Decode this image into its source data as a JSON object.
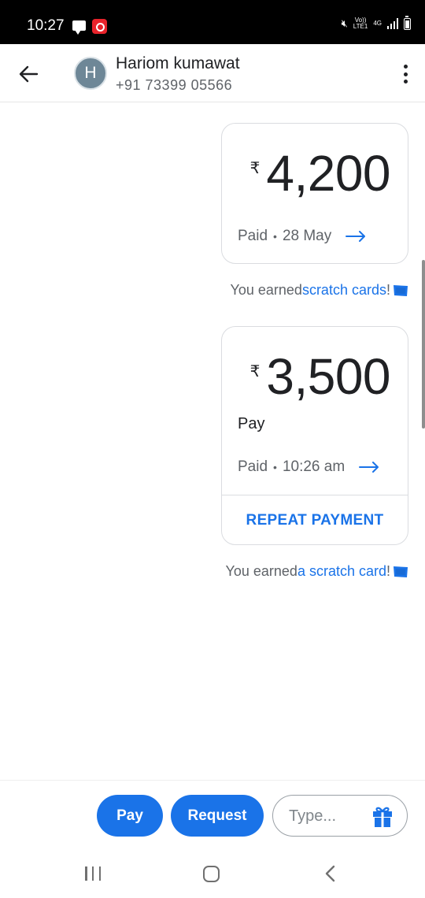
{
  "status_bar": {
    "time": "10:27",
    "volte_label": "Vo)) LTE1",
    "network_label": "4G"
  },
  "header": {
    "avatar_initial": "H",
    "contact_name": "Hariom kumawat",
    "contact_phone": "+91 73399 05566"
  },
  "payments": [
    {
      "currency_symbol": "₹",
      "amount": "4,200",
      "note": "",
      "status": "Paid",
      "date": "28 May"
    },
    {
      "currency_symbol": "₹",
      "amount": "3,500",
      "note": "Pay",
      "status": "Paid",
      "date": "10:26 am",
      "action_label": "REPEAT PAYMENT"
    }
  ],
  "rewards": [
    {
      "prefix": "You earned ",
      "link": "scratch cards",
      "suffix": "!"
    },
    {
      "prefix": "You earned ",
      "link": "a scratch card",
      "suffix": "!"
    }
  ],
  "composer": {
    "pay_label": "Pay",
    "request_label": "Request",
    "type_placeholder": "Type..."
  },
  "colors": {
    "accent": "#1a73e8",
    "avatar_bg": "#6e8797",
    "status_bar_bg": "#000000"
  }
}
